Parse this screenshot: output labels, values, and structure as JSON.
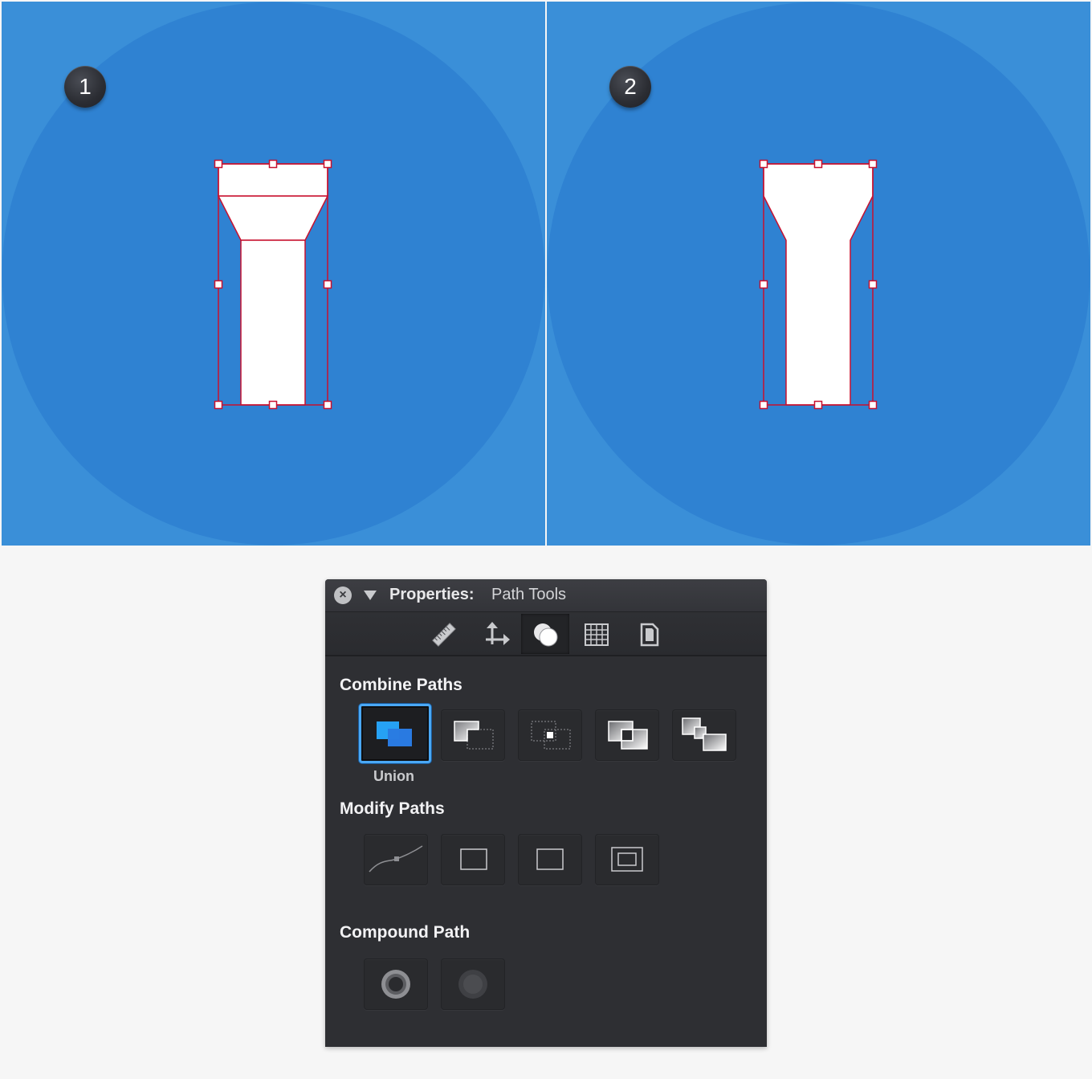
{
  "canvas": {
    "artboards": [
      {
        "step": "1"
      },
      {
        "step": "2"
      }
    ],
    "background_color": "#3a8fd8",
    "circle_color": "#2f82d2",
    "shape_fill": "#ffffff",
    "selection_color": "#c8102e"
  },
  "panel": {
    "title_label": "Properties:",
    "title_value": "Path Tools",
    "close_icon": "close-icon",
    "toolbar_tabs": [
      {
        "icon": "ruler-icon",
        "active": false
      },
      {
        "icon": "move-arrows-icon",
        "active": false
      },
      {
        "icon": "path-tools-icon",
        "active": true
      },
      {
        "icon": "grid-icon",
        "active": false
      },
      {
        "icon": "document-icon",
        "active": false
      }
    ],
    "sections": {
      "combine": {
        "title": "Combine Paths",
        "selected_label": "Union",
        "buttons": [
          "union-icon",
          "subtract-icon",
          "intersect-icon",
          "exclude-icon",
          "divide-icon"
        ]
      },
      "modify": {
        "title": "Modify Paths",
        "buttons": [
          "simplify-path-icon",
          "offset-path-icon",
          "outline-stroke-icon",
          "inset-path-icon"
        ]
      },
      "compound": {
        "title": "Compound Path",
        "buttons": [
          "make-compound-icon",
          "release-compound-icon"
        ]
      }
    },
    "accent_color": "#4aa8f5"
  }
}
